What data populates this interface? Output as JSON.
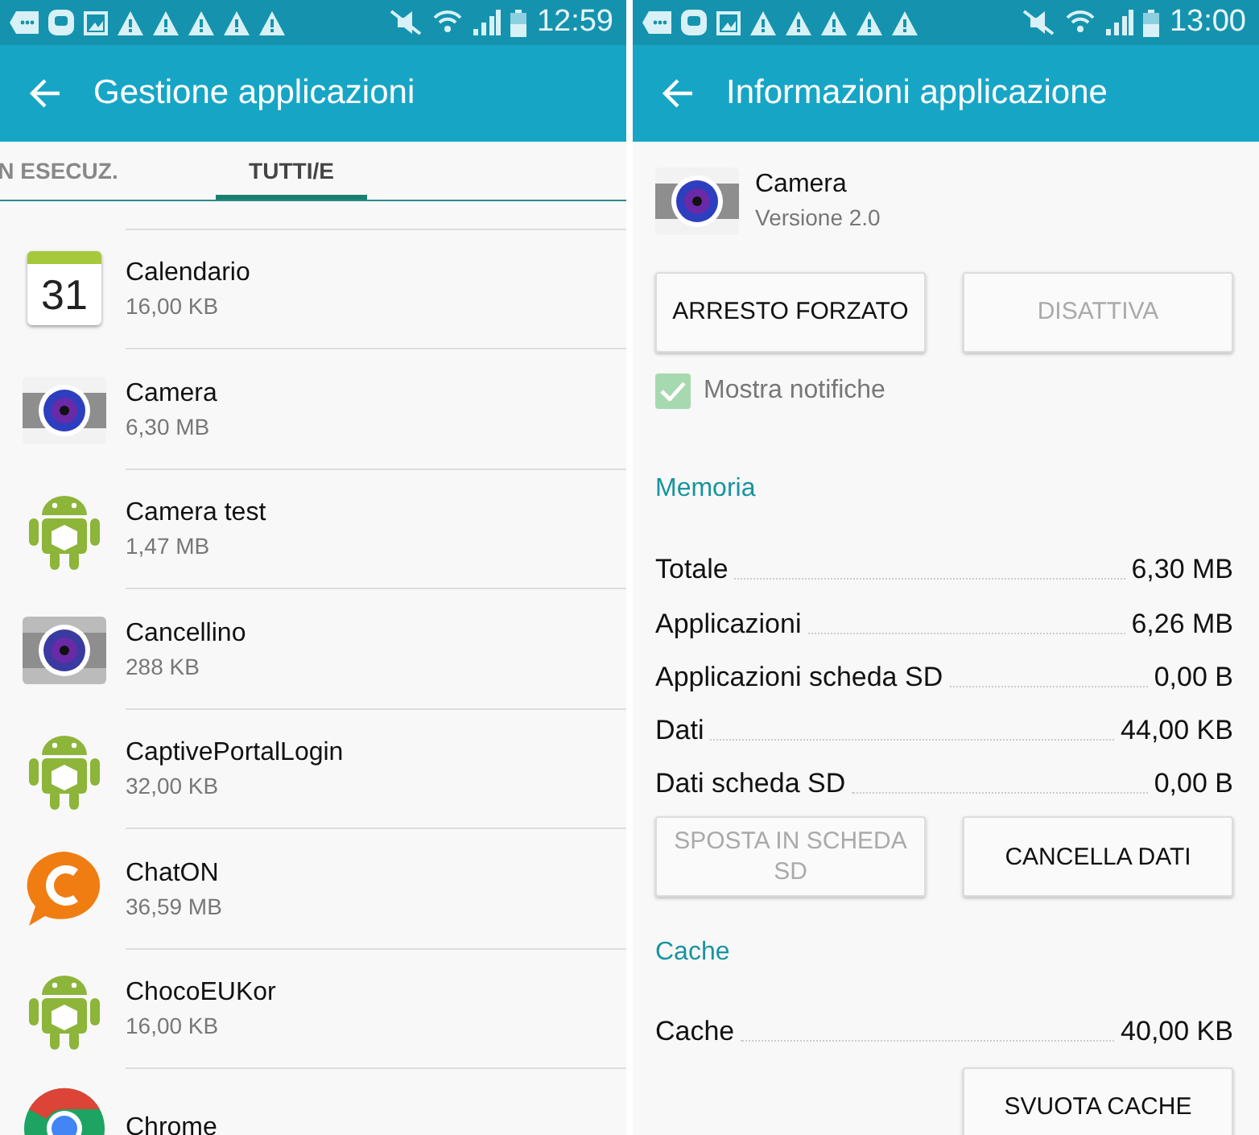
{
  "left_screen": {
    "status_bar": {
      "time": "12:59"
    },
    "app_bar": {
      "title": "Gestione applicazioni"
    },
    "tabs": [
      {
        "label": "N ESECUZ.",
        "selected": false
      },
      {
        "label": "TUTTI/E",
        "selected": true
      }
    ],
    "apps": [
      {
        "kind": "calendar",
        "name": "Calendario",
        "size": "16,00 KB",
        "icon_label": "31"
      },
      {
        "kind": "camera",
        "name": "Camera",
        "size": "6,30 MB"
      },
      {
        "kind": "android",
        "name": "Camera test",
        "size": "1,47 MB"
      },
      {
        "kind": "camera_grey",
        "name": "Cancellino",
        "size": "288 KB"
      },
      {
        "kind": "android",
        "name": "CaptivePortalLogin",
        "size": "32,00 KB"
      },
      {
        "kind": "chaton",
        "name": "ChatON",
        "size": "36,59 MB"
      },
      {
        "kind": "android",
        "name": "ChocoEUKor",
        "size": "16,00 KB"
      },
      {
        "kind": "chrome",
        "name": "Chrome"
      }
    ]
  },
  "right_screen": {
    "status_bar": {
      "time": "13:00"
    },
    "app_bar": {
      "title": "Informazioni applicazione"
    },
    "app": {
      "name": "Camera",
      "version": "Versione 2.0"
    },
    "buttons": [
      {
        "label": "ARRESTO FORZATO",
        "disabled": false
      },
      {
        "label": "DISATTIVA",
        "disabled": true
      }
    ],
    "notifications": {
      "label": "Mostra notifiche",
      "checked": true,
      "disabled": true
    },
    "sections": [
      {
        "title": "Memoria",
        "rows": [
          {
            "label": "Totale",
            "value": "6,30 MB"
          },
          {
            "label": "Applicazioni",
            "value": "6,26 MB"
          },
          {
            "label": "Applicazioni scheda SD",
            "value": "0,00 B"
          },
          {
            "label": "Dati",
            "value": "44,00 KB"
          },
          {
            "label": "Dati scheda SD",
            "value": "0,00 B"
          }
        ],
        "buttons": [
          {
            "label": "SPOSTA IN SCHEDA SD",
            "disabled": true
          },
          {
            "label": "CANCELLA DATI",
            "disabled": false
          }
        ]
      },
      {
        "title": "Cache",
        "rows": [
          {
            "label": "Cache",
            "value": "40,00 KB"
          }
        ],
        "buttons": [
          {
            "label": "SVUOTA CACHE",
            "disabled": false
          }
        ]
      }
    ]
  }
}
